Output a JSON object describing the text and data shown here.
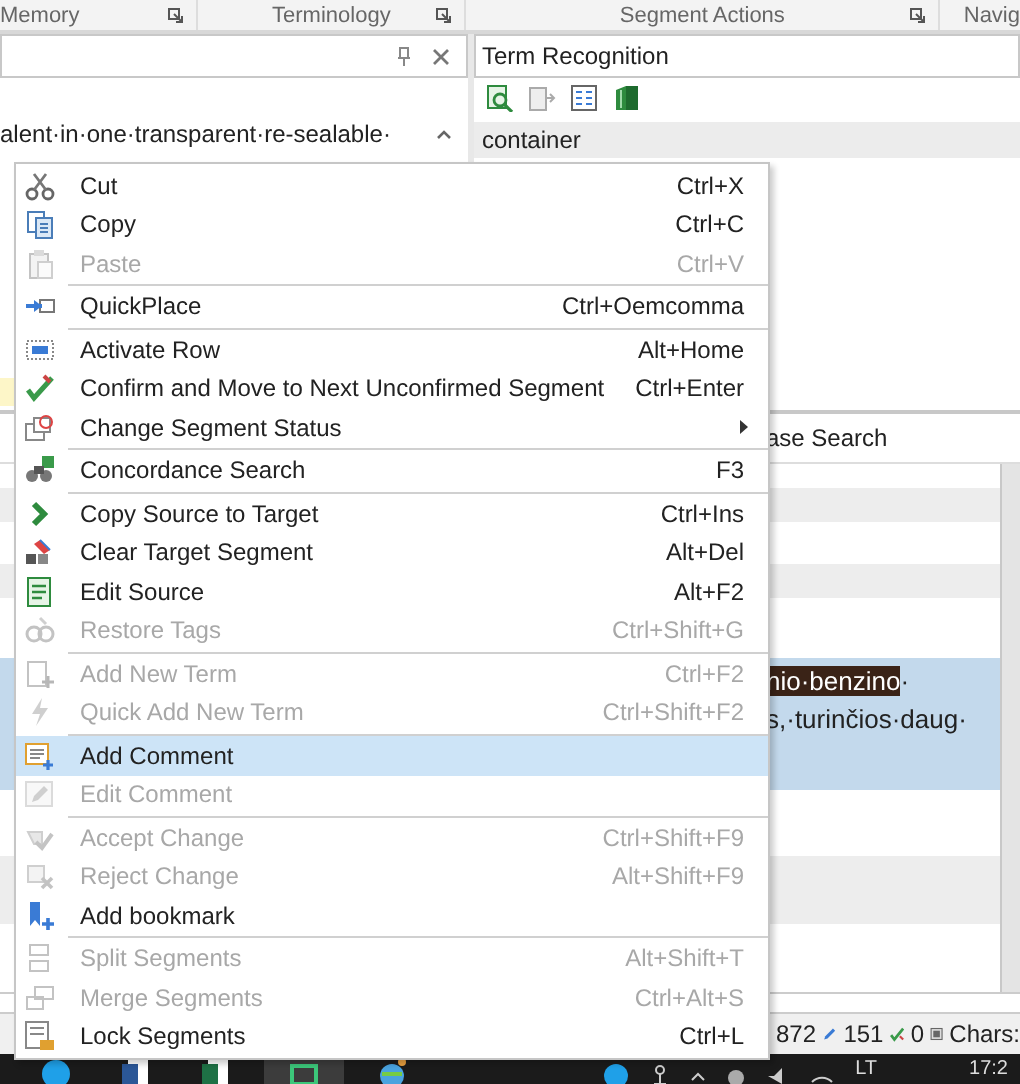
{
  "ribbon_groups": [
    {
      "label": "Memory"
    },
    {
      "label": "Terminology"
    },
    {
      "label": "Segment Actions"
    },
    {
      "label": "Navig"
    }
  ],
  "editor_panel": {
    "text": "alent·in·one·transparent·re-sealable·"
  },
  "term_recognition": {
    "title": "Term Recognition",
    "term": "container"
  },
  "lower_panel": {
    "tab_label": "ase Search"
  },
  "segment": {
    "highlighted_text": "nio·benzino",
    "text_after": "·",
    "line_2": "s,·turinčios·daug·"
  },
  "status_bar": {
    "counts": [
      "872",
      "151",
      "0"
    ],
    "chars_label": "Chars:"
  },
  "taskbar": {
    "language": "LT",
    "time": "17:2"
  },
  "context_menu": {
    "items": [
      {
        "kind": "item",
        "label": "Cut",
        "shortcut": "Ctrl+X",
        "disabled": false,
        "selected": false,
        "submenu": false
      },
      {
        "kind": "item",
        "label": "Copy",
        "shortcut": "Ctrl+C",
        "disabled": false,
        "selected": false,
        "submenu": false
      },
      {
        "kind": "item",
        "label": "Paste",
        "shortcut": "Ctrl+V",
        "disabled": true,
        "selected": false,
        "submenu": false
      },
      {
        "kind": "separator"
      },
      {
        "kind": "item",
        "label": "QuickPlace",
        "shortcut": "Ctrl+Oemcomma",
        "disabled": false,
        "selected": false,
        "submenu": false
      },
      {
        "kind": "separator"
      },
      {
        "kind": "item",
        "label": "Activate Row",
        "shortcut": "Alt+Home",
        "disabled": false,
        "selected": false,
        "submenu": false
      },
      {
        "kind": "item",
        "label": "Confirm and Move to Next Unconfirmed Segment",
        "shortcut": "Ctrl+Enter",
        "disabled": false,
        "selected": false,
        "submenu": false
      },
      {
        "kind": "item",
        "label": "Change Segment Status",
        "disabled": false,
        "selected": false,
        "submenu": true
      },
      {
        "kind": "separator"
      },
      {
        "kind": "item",
        "label": "Concordance Search",
        "shortcut": "F3",
        "disabled": false,
        "selected": false,
        "submenu": false
      },
      {
        "kind": "separator"
      },
      {
        "kind": "item",
        "label": "Copy Source to Target",
        "shortcut": "Ctrl+Ins",
        "disabled": false,
        "selected": false,
        "submenu": false
      },
      {
        "kind": "item",
        "label": "Clear Target Segment",
        "shortcut": "Alt+Del",
        "disabled": false,
        "selected": false,
        "submenu": false
      },
      {
        "kind": "item",
        "label": "Edit Source",
        "shortcut": "Alt+F2",
        "disabled": false,
        "selected": false,
        "submenu": false
      },
      {
        "kind": "item",
        "label": "Restore Tags",
        "shortcut": "Ctrl+Shift+G",
        "disabled": true,
        "selected": false,
        "submenu": false
      },
      {
        "kind": "separator"
      },
      {
        "kind": "item",
        "label": "Add New Term",
        "shortcut": "Ctrl+F2",
        "disabled": true,
        "selected": false,
        "submenu": false
      },
      {
        "kind": "item",
        "label": "Quick Add New Term",
        "shortcut": "Ctrl+Shift+F2",
        "disabled": true,
        "selected": false,
        "submenu": false
      },
      {
        "kind": "separator"
      },
      {
        "kind": "item",
        "label": "Add Comment",
        "disabled": false,
        "selected": true,
        "submenu": false
      },
      {
        "kind": "item",
        "label": "Edit Comment",
        "disabled": true,
        "selected": false,
        "submenu": false
      },
      {
        "kind": "separator"
      },
      {
        "kind": "item",
        "label": "Accept Change",
        "shortcut": "Ctrl+Shift+F9",
        "disabled": true,
        "selected": false,
        "submenu": false
      },
      {
        "kind": "item",
        "label": "Reject Change",
        "shortcut": "Alt+Shift+F9",
        "disabled": true,
        "selected": false,
        "submenu": false
      },
      {
        "kind": "item",
        "label": "Add bookmark",
        "disabled": false,
        "selected": false,
        "submenu": false
      },
      {
        "kind": "separator"
      },
      {
        "kind": "item",
        "label": "Split Segments",
        "shortcut": "Alt+Shift+T",
        "disabled": true,
        "selected": false,
        "submenu": false
      },
      {
        "kind": "item",
        "label": "Merge Segments",
        "shortcut": "Ctrl+Alt+S",
        "disabled": true,
        "selected": false,
        "submenu": false
      },
      {
        "kind": "item",
        "label": "Lock Segments",
        "shortcut": "Ctrl+L",
        "disabled": false,
        "selected": false,
        "submenu": false
      }
    ]
  }
}
